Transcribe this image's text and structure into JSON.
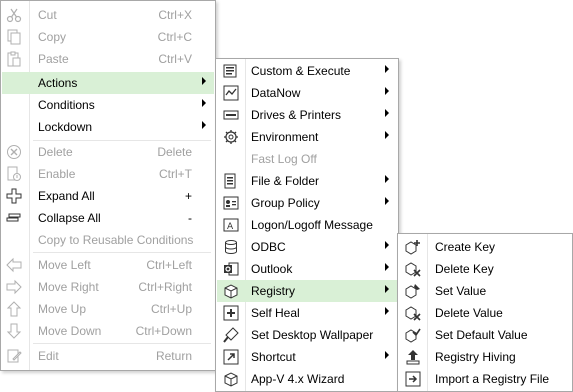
{
  "main_menu": {
    "items": [
      {
        "label": "Cut",
        "shortcut": "Ctrl+X",
        "icon": "scissors-icon"
      },
      {
        "label": "Copy",
        "shortcut": "Ctrl+C",
        "icon": "copy-icon"
      },
      {
        "label": "Paste",
        "shortcut": "Ctrl+V",
        "icon": "paste-icon"
      },
      {
        "label": "Actions",
        "icon": ""
      },
      {
        "label": "Conditions",
        "icon": ""
      },
      {
        "label": "Lockdown",
        "icon": ""
      },
      {
        "label": "Delete",
        "shortcut": "Delete",
        "icon": "delete-circle-icon"
      },
      {
        "label": "Enable",
        "shortcut": "Ctrl+T",
        "icon": "enable-icon"
      },
      {
        "label": "Expand All",
        "shortcut": "+",
        "icon": "expand-icon"
      },
      {
        "label": "Collapse All",
        "shortcut": "-",
        "icon": "collapse-icon"
      },
      {
        "label": "Copy to Reusable Conditions",
        "icon": ""
      },
      {
        "label": "Move Left",
        "shortcut": "Ctrl+Left",
        "icon": "arrow-left-icon"
      },
      {
        "label": "Move Right",
        "shortcut": "Ctrl+Right",
        "icon": "arrow-right-icon"
      },
      {
        "label": "Move Up",
        "shortcut": "Ctrl+Up",
        "icon": "arrow-up-icon"
      },
      {
        "label": "Move Down",
        "shortcut": "Ctrl+Down",
        "icon": "arrow-down-icon"
      },
      {
        "label": "Edit",
        "shortcut": "Return",
        "icon": "edit-icon"
      }
    ]
  },
  "actions_menu": {
    "items": [
      {
        "label": "Custom & Execute",
        "icon": "custom-execute-icon"
      },
      {
        "label": "DataNow",
        "icon": "datanow-icon"
      },
      {
        "label": "Drives & Printers",
        "icon": "drives-printers-icon"
      },
      {
        "label": "Environment",
        "icon": "gear-icon"
      },
      {
        "label": "Fast Log Off",
        "icon": ""
      },
      {
        "label": "File & Folder",
        "icon": "file-folder-icon"
      },
      {
        "label": "Group Policy",
        "icon": "group-policy-icon"
      },
      {
        "label": "Logon/Logoff Message",
        "icon": "message-icon"
      },
      {
        "label": "ODBC",
        "icon": "database-icon"
      },
      {
        "label": "Outlook",
        "icon": "outlook-icon"
      },
      {
        "label": "Registry",
        "icon": "registry-icon"
      },
      {
        "label": "Self Heal",
        "icon": "self-heal-icon"
      },
      {
        "label": "Set Desktop Wallpaper",
        "icon": "wallpaper-icon"
      },
      {
        "label": "Shortcut",
        "icon": "shortcut-icon"
      },
      {
        "label": "App-V 4.x Wizard",
        "icon": "appv-icon"
      }
    ]
  },
  "registry_menu": {
    "items": [
      {
        "label": "Create Key",
        "icon": "create-key-icon"
      },
      {
        "label": "Delete Key",
        "icon": "delete-key-icon"
      },
      {
        "label": "Set Value",
        "icon": "set-value-icon"
      },
      {
        "label": "Delete Value",
        "icon": "delete-value-icon"
      },
      {
        "label": "Set Default Value",
        "icon": "set-default-value-icon"
      },
      {
        "label": "Registry Hiving",
        "icon": "registry-hiving-icon"
      },
      {
        "label": "Import a Registry File",
        "icon": "import-registry-icon"
      }
    ]
  },
  "colors": {
    "highlight": "#d9f0d6",
    "disabled_text": "#a0a0a0",
    "border": "#a8a8a8"
  }
}
